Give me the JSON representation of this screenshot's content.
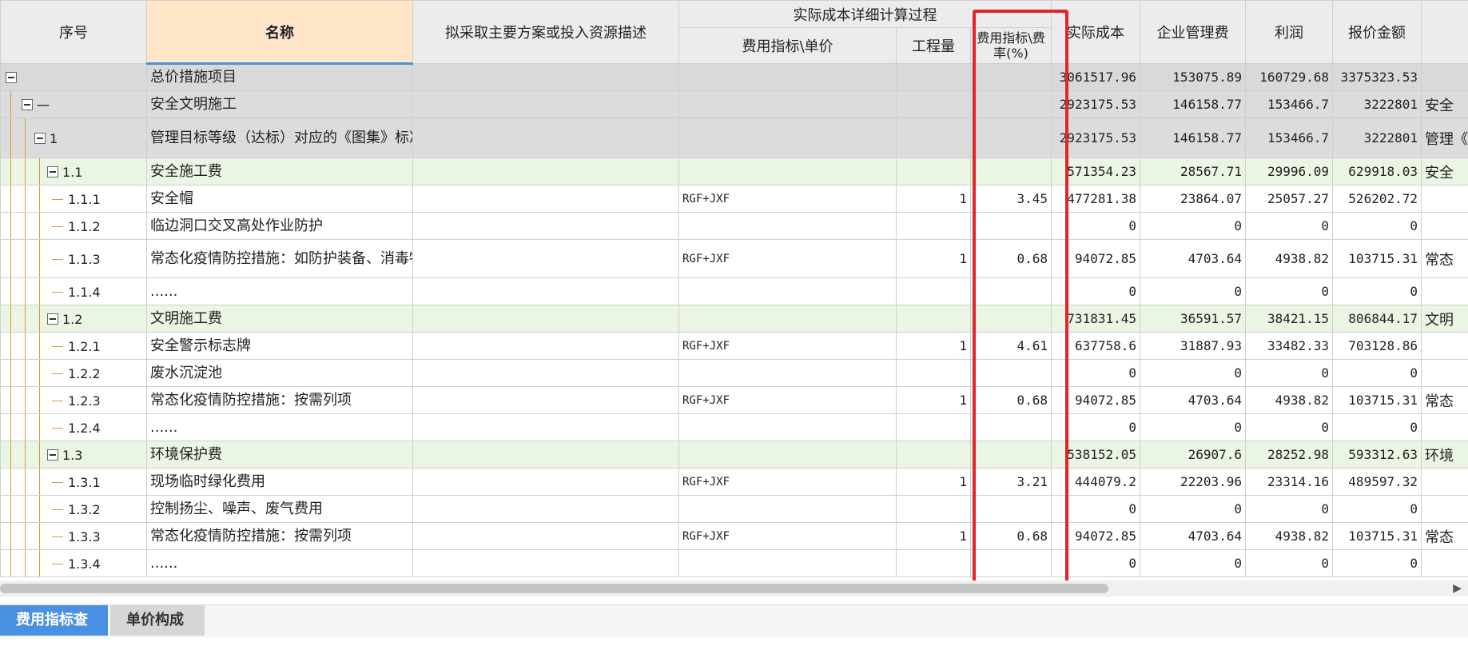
{
  "headers": {
    "seq": "序号",
    "name": "名称",
    "desc": "拟采取主要方案或投入资源描述",
    "group": "实际成本详细计算过程",
    "fee_index": "费用指标\\单价",
    "qty": "工程量",
    "rate": "费用指标\\费率(%)",
    "actual_cost": "实际成本",
    "mgmt_fee": "企业管理费",
    "profit": "利润",
    "quote": "报价金额"
  },
  "rows": [
    {
      "level": "total",
      "seq": "",
      "name": "总价措施项目",
      "formula": "",
      "qty": "",
      "rate": "",
      "cost": "3061517.96",
      "mgmt": "153075.89",
      "profit": "160729.68",
      "quote": "3375323.53",
      "extra": ""
    },
    {
      "level": "l1",
      "seq": "一",
      "name": "安全文明施工",
      "formula": "",
      "qty": "",
      "rate": "",
      "cost": "2923175.53",
      "mgmt": "146158.77",
      "profit": "153466.7",
      "quote": "3222801",
      "extra": "安全"
    },
    {
      "level": "l2",
      "seq": "1",
      "name": "管理目标等级（达标）对应的《图集》标准内项目措施费",
      "formula": "",
      "qty": "",
      "rate": "",
      "cost": "2923175.53",
      "mgmt": "146158.77",
      "profit": "153466.7",
      "quote": "3222801",
      "extra": "管理《图"
    },
    {
      "level": "l3",
      "seq": "1.1",
      "name": "安全施工费",
      "formula": "",
      "qty": "",
      "rate": "",
      "cost": "571354.23",
      "mgmt": "28567.71",
      "profit": "29996.09",
      "quote": "629918.03",
      "extra": "安全"
    },
    {
      "level": "leaf",
      "seq": "1.1.1",
      "name": "安全帽",
      "formula": "RGF+JXF",
      "qty": "1",
      "rate": "3.45",
      "cost": "477281.38",
      "mgmt": "23864.07",
      "profit": "25057.27",
      "quote": "526202.72",
      "extra": ""
    },
    {
      "level": "leaf",
      "seq": "1.1.2",
      "name": "临边洞口交叉高处作业防护",
      "formula": "",
      "qty": "",
      "rate": "",
      "cost": "0",
      "mgmt": "0",
      "profit": "0",
      "quote": "0",
      "extra": ""
    },
    {
      "level": "leaf",
      "seq": "1.1.3",
      "name": "常态化疫情防控措施：如防护装备、消毒物资...",
      "formula": "RGF+JXF",
      "qty": "1",
      "rate": "0.68",
      "cost": "94072.85",
      "mgmt": "4703.64",
      "profit": "4938.82",
      "quote": "103715.31",
      "extra": "常态"
    },
    {
      "level": "leaf",
      "seq": "1.1.4",
      "name": "......",
      "formula": "",
      "qty": "",
      "rate": "",
      "cost": "0",
      "mgmt": "0",
      "profit": "0",
      "quote": "0",
      "extra": ""
    },
    {
      "level": "l3",
      "seq": "1.2",
      "name": "文明施工费",
      "formula": "",
      "qty": "",
      "rate": "",
      "cost": "731831.45",
      "mgmt": "36591.57",
      "profit": "38421.15",
      "quote": "806844.17",
      "extra": "文明"
    },
    {
      "level": "leaf",
      "seq": "1.2.1",
      "name": "安全警示标志牌",
      "formula": "RGF+JXF",
      "qty": "1",
      "rate": "4.61",
      "cost": "637758.6",
      "mgmt": "31887.93",
      "profit": "33482.33",
      "quote": "703128.86",
      "extra": ""
    },
    {
      "level": "leaf",
      "seq": "1.2.2",
      "name": "废水沉淀池",
      "formula": "",
      "qty": "",
      "rate": "",
      "cost": "0",
      "mgmt": "0",
      "profit": "0",
      "quote": "0",
      "extra": ""
    },
    {
      "level": "leaf",
      "seq": "1.2.3",
      "name": "常态化疫情防控措施：按需列项",
      "formula": "RGF+JXF",
      "qty": "1",
      "rate": "0.68",
      "cost": "94072.85",
      "mgmt": "4703.64",
      "profit": "4938.82",
      "quote": "103715.31",
      "extra": "常态"
    },
    {
      "level": "leaf",
      "seq": "1.2.4",
      "name": "......",
      "formula": "",
      "qty": "",
      "rate": "",
      "cost": "0",
      "mgmt": "0",
      "profit": "0",
      "quote": "0",
      "extra": ""
    },
    {
      "level": "l3",
      "seq": "1.3",
      "name": "环境保护费",
      "formula": "",
      "qty": "",
      "rate": "",
      "cost": "538152.05",
      "mgmt": "26907.6",
      "profit": "28252.98",
      "quote": "593312.63",
      "extra": "环境"
    },
    {
      "level": "leaf",
      "seq": "1.3.1",
      "name": "现场临时绿化费用",
      "formula": "RGF+JXF",
      "qty": "1",
      "rate": "3.21",
      "cost": "444079.2",
      "mgmt": "22203.96",
      "profit": "23314.16",
      "quote": "489597.32",
      "extra": ""
    },
    {
      "level": "leaf",
      "seq": "1.3.2",
      "name": "控制扬尘、噪声、废气费用",
      "formula": "",
      "qty": "",
      "rate": "",
      "cost": "0",
      "mgmt": "0",
      "profit": "0",
      "quote": "0",
      "extra": ""
    },
    {
      "level": "leaf",
      "seq": "1.3.3",
      "name": "常态化疫情防控措施：按需列项",
      "formula": "RGF+JXF",
      "qty": "1",
      "rate": "0.68",
      "cost": "94072.85",
      "mgmt": "4703.64",
      "profit": "4938.82",
      "quote": "103715.31",
      "extra": "常态"
    },
    {
      "level": "leaf",
      "seq": "1.3.4",
      "name": "......",
      "formula": "",
      "qty": "",
      "rate": "",
      "cost": "0",
      "mgmt": "0",
      "profit": "0",
      "quote": "0",
      "extra": ""
    }
  ],
  "tabs": [
    {
      "label": "费用指标查看",
      "active": true
    },
    {
      "label": "单价构成",
      "active": false
    }
  ],
  "colors": {
    "name_header_bg": "#ffe6c8",
    "highlight_box": "#e3242b",
    "active_tab": "#4a90e2",
    "subtotal_row": "#eaf5e3",
    "tree_line": "#d69d2b"
  }
}
